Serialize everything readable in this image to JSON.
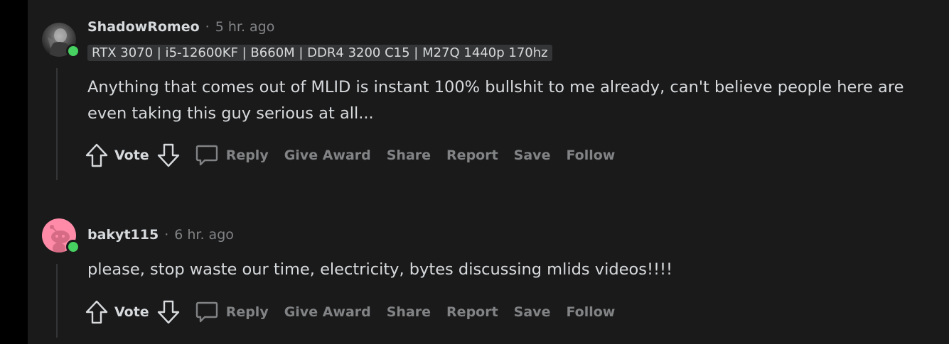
{
  "comments": [
    {
      "username": "ShadowRomeo",
      "separator": "·",
      "time": "5 hr. ago",
      "flair": "RTX 3070 | i5-12600KF | B660M | DDR4 3200 C15 | M27Q 1440p 170hz",
      "body": "Anything that comes out of MLID is instant 100% bullshit to me already, can't believe people here are even taking this guy serious at all...",
      "avatar_style": "photo-dark",
      "online": true
    },
    {
      "username": "bakyt115",
      "separator": "·",
      "time": "6 hr. ago",
      "flair": "",
      "body": "please, stop waste our time, electricity, bytes discussing mlids videos!!!!",
      "avatar_style": "snoo-pink",
      "online": true
    }
  ],
  "actions": {
    "vote": "Vote",
    "reply": "Reply",
    "give_award": "Give Award",
    "share": "Share",
    "report": "Report",
    "save": "Save",
    "follow": "Follow"
  },
  "colors": {
    "background": "#1a1a1b",
    "text": "#d7dadc",
    "muted": "#818384",
    "online": "#46d160",
    "avatar_pink": "#ff8ba8"
  },
  "icons": [
    "upvote-icon",
    "downvote-icon",
    "reply-bubble-icon"
  ]
}
